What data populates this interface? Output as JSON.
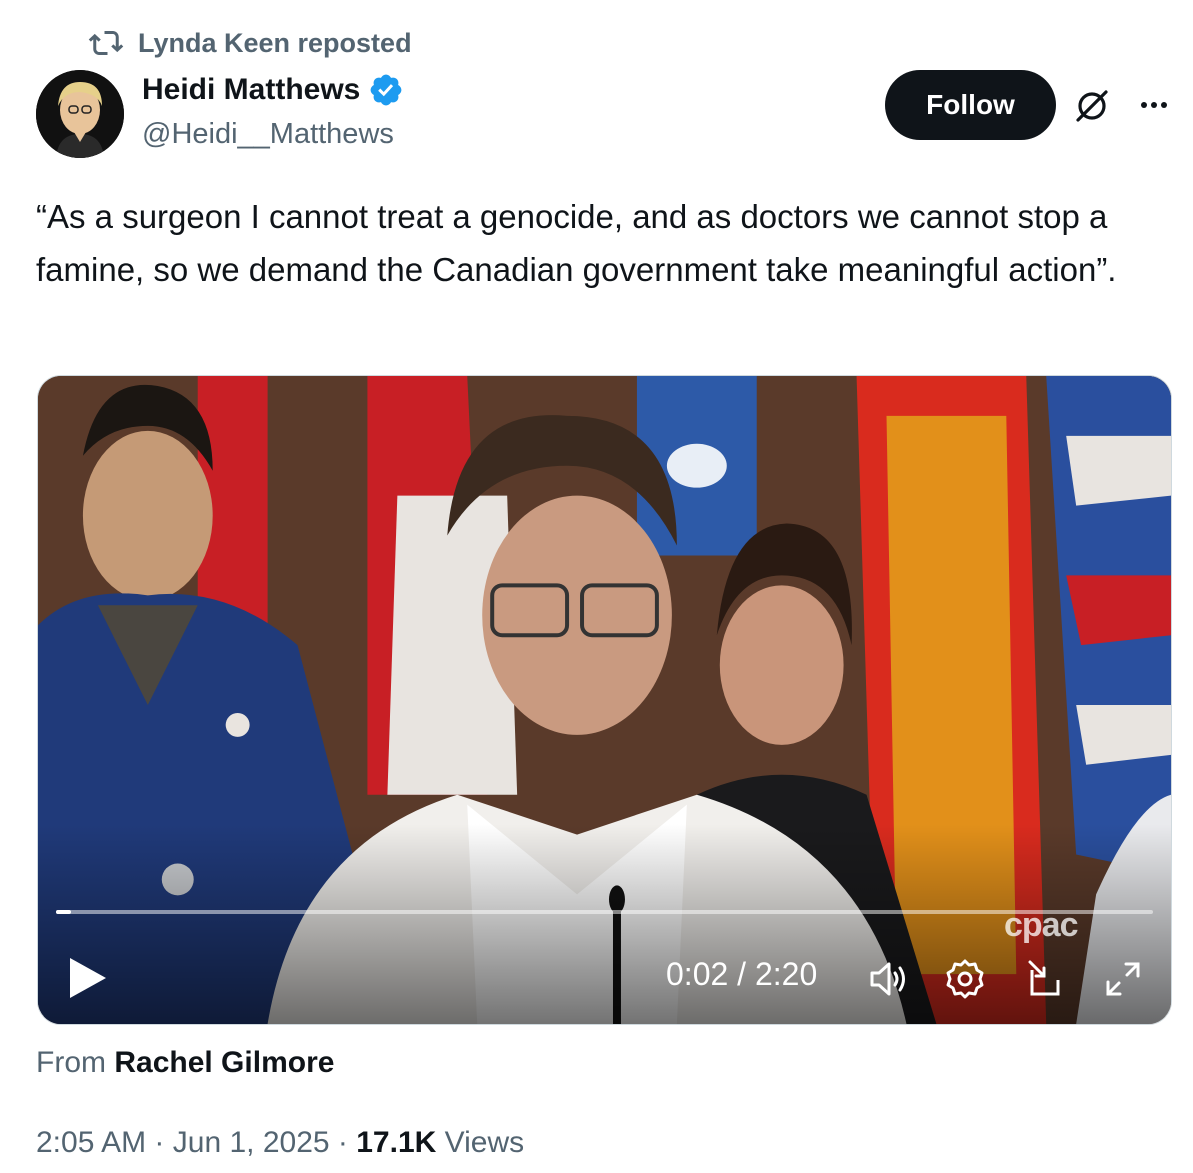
{
  "repost": {
    "label": "Lynda Keen reposted",
    "icon": "repost-icon"
  },
  "author": {
    "name": "Heidi Matthews",
    "handle": "@Heidi__Matthews",
    "verified_icon": "verified-badge-icon",
    "verified_color": "#1d9bf0"
  },
  "actions": {
    "follow_label": "Follow",
    "grok_icon": "grok-icon",
    "more_icon": "more-icon"
  },
  "tweet": {
    "text": "“As a surgeon I cannot treat a genocide, and as doctors we cannot stop a famine, so we demand the Canadian government take meaningful action”."
  },
  "video": {
    "current_time": "0:02",
    "separator": "/",
    "duration": "2:20",
    "time_display": "0:02 / 2:20",
    "progress_fraction": 0.014,
    "watermark": "cpac",
    "controls": [
      "play-icon",
      "volume-icon",
      "settings-icon",
      "pip-icon",
      "fullscreen-icon"
    ]
  },
  "source": {
    "prefix": "From",
    "name": "Rachel Gilmore"
  },
  "meta": {
    "time": "2:05 AM",
    "date": "Jun 1, 2025",
    "views_count": "17.1K",
    "views_label": "Views",
    "dot": "·"
  },
  "colors": {
    "text_primary": "#0f1419",
    "text_secondary": "#536471",
    "follow_bg": "#0f1419",
    "accent": "#1d9bf0"
  }
}
